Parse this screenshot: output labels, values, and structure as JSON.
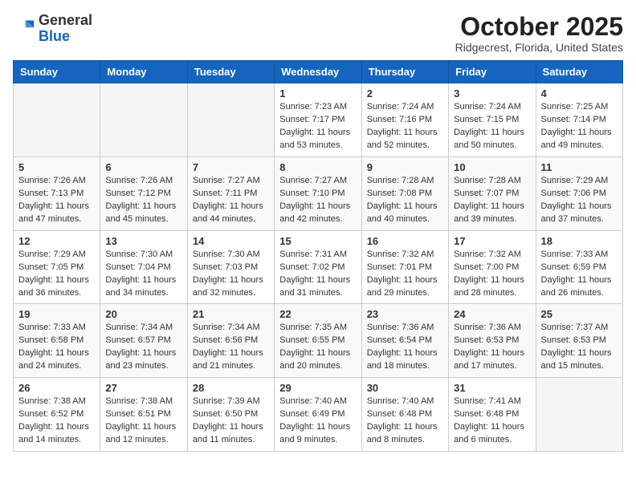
{
  "header": {
    "logo": {
      "line1": "General",
      "line2": "Blue"
    },
    "title": "October 2025",
    "location": "Ridgecrest, Florida, United States"
  },
  "weekdays": [
    "Sunday",
    "Monday",
    "Tuesday",
    "Wednesday",
    "Thursday",
    "Friday",
    "Saturday"
  ],
  "weeks": [
    [
      {
        "day": null,
        "info": null
      },
      {
        "day": null,
        "info": null
      },
      {
        "day": null,
        "info": null
      },
      {
        "day": "1",
        "info": "Sunrise: 7:23 AM\nSunset: 7:17 PM\nDaylight: 11 hours\nand 53 minutes."
      },
      {
        "day": "2",
        "info": "Sunrise: 7:24 AM\nSunset: 7:16 PM\nDaylight: 11 hours\nand 52 minutes."
      },
      {
        "day": "3",
        "info": "Sunrise: 7:24 AM\nSunset: 7:15 PM\nDaylight: 11 hours\nand 50 minutes."
      },
      {
        "day": "4",
        "info": "Sunrise: 7:25 AM\nSunset: 7:14 PM\nDaylight: 11 hours\nand 49 minutes."
      }
    ],
    [
      {
        "day": "5",
        "info": "Sunrise: 7:26 AM\nSunset: 7:13 PM\nDaylight: 11 hours\nand 47 minutes."
      },
      {
        "day": "6",
        "info": "Sunrise: 7:26 AM\nSunset: 7:12 PM\nDaylight: 11 hours\nand 45 minutes."
      },
      {
        "day": "7",
        "info": "Sunrise: 7:27 AM\nSunset: 7:11 PM\nDaylight: 11 hours\nand 44 minutes."
      },
      {
        "day": "8",
        "info": "Sunrise: 7:27 AM\nSunset: 7:10 PM\nDaylight: 11 hours\nand 42 minutes."
      },
      {
        "day": "9",
        "info": "Sunrise: 7:28 AM\nSunset: 7:08 PM\nDaylight: 11 hours\nand 40 minutes."
      },
      {
        "day": "10",
        "info": "Sunrise: 7:28 AM\nSunset: 7:07 PM\nDaylight: 11 hours\nand 39 minutes."
      },
      {
        "day": "11",
        "info": "Sunrise: 7:29 AM\nSunset: 7:06 PM\nDaylight: 11 hours\nand 37 minutes."
      }
    ],
    [
      {
        "day": "12",
        "info": "Sunrise: 7:29 AM\nSunset: 7:05 PM\nDaylight: 11 hours\nand 36 minutes."
      },
      {
        "day": "13",
        "info": "Sunrise: 7:30 AM\nSunset: 7:04 PM\nDaylight: 11 hours\nand 34 minutes."
      },
      {
        "day": "14",
        "info": "Sunrise: 7:30 AM\nSunset: 7:03 PM\nDaylight: 11 hours\nand 32 minutes."
      },
      {
        "day": "15",
        "info": "Sunrise: 7:31 AM\nSunset: 7:02 PM\nDaylight: 11 hours\nand 31 minutes."
      },
      {
        "day": "16",
        "info": "Sunrise: 7:32 AM\nSunset: 7:01 PM\nDaylight: 11 hours\nand 29 minutes."
      },
      {
        "day": "17",
        "info": "Sunrise: 7:32 AM\nSunset: 7:00 PM\nDaylight: 11 hours\nand 28 minutes."
      },
      {
        "day": "18",
        "info": "Sunrise: 7:33 AM\nSunset: 6:59 PM\nDaylight: 11 hours\nand 26 minutes."
      }
    ],
    [
      {
        "day": "19",
        "info": "Sunrise: 7:33 AM\nSunset: 6:58 PM\nDaylight: 11 hours\nand 24 minutes."
      },
      {
        "day": "20",
        "info": "Sunrise: 7:34 AM\nSunset: 6:57 PM\nDaylight: 11 hours\nand 23 minutes."
      },
      {
        "day": "21",
        "info": "Sunrise: 7:34 AM\nSunset: 6:56 PM\nDaylight: 11 hours\nand 21 minutes."
      },
      {
        "day": "22",
        "info": "Sunrise: 7:35 AM\nSunset: 6:55 PM\nDaylight: 11 hours\nand 20 minutes."
      },
      {
        "day": "23",
        "info": "Sunrise: 7:36 AM\nSunset: 6:54 PM\nDaylight: 11 hours\nand 18 minutes."
      },
      {
        "day": "24",
        "info": "Sunrise: 7:36 AM\nSunset: 6:53 PM\nDaylight: 11 hours\nand 17 minutes."
      },
      {
        "day": "25",
        "info": "Sunrise: 7:37 AM\nSunset: 6:53 PM\nDaylight: 11 hours\nand 15 minutes."
      }
    ],
    [
      {
        "day": "26",
        "info": "Sunrise: 7:38 AM\nSunset: 6:52 PM\nDaylight: 11 hours\nand 14 minutes."
      },
      {
        "day": "27",
        "info": "Sunrise: 7:38 AM\nSunset: 6:51 PM\nDaylight: 11 hours\nand 12 minutes."
      },
      {
        "day": "28",
        "info": "Sunrise: 7:39 AM\nSunset: 6:50 PM\nDaylight: 11 hours\nand 11 minutes."
      },
      {
        "day": "29",
        "info": "Sunrise: 7:40 AM\nSunset: 6:49 PM\nDaylight: 11 hours\nand 9 minutes."
      },
      {
        "day": "30",
        "info": "Sunrise: 7:40 AM\nSunset: 6:48 PM\nDaylight: 11 hours\nand 8 minutes."
      },
      {
        "day": "31",
        "info": "Sunrise: 7:41 AM\nSunset: 6:48 PM\nDaylight: 11 hours\nand 6 minutes."
      },
      {
        "day": null,
        "info": null
      }
    ]
  ]
}
